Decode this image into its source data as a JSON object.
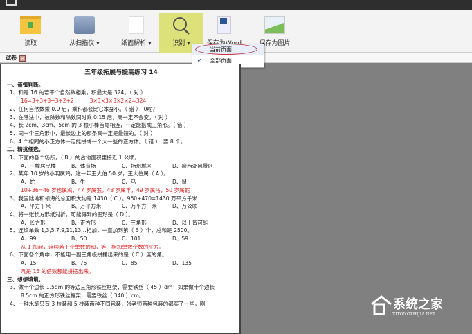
{
  "toolbar": {
    "items": [
      {
        "label": "读取"
      },
      {
        "label": "从扫描仪 ▾"
      },
      {
        "label": "纸面解析 ▾"
      },
      {
        "label": "识别 ▾"
      },
      {
        "label": "保存为Word"
      },
      {
        "label": "保存为图片"
      }
    ]
  },
  "tab": {
    "label": "试卷"
  },
  "dropdown": {
    "items": [
      {
        "label": "当前页面",
        "checked": false
      },
      {
        "label": "全部页面",
        "checked": true
      }
    ]
  },
  "doc": {
    "title": "五年级拓展与提高练习 14",
    "s1": "一、谨慎判断。",
    "s1q": [
      "1、和是 16 的若干个自然数相乘，积最大是 324。（ 对 ）",
      "16=3+3+3+3+2+2　　　3×3×3×3×2×2=324",
      "2、任何自然数乘 0.9 后，乘积都会比它本身小。（ 错 ）　0呢？",
      "3、在除法中，被除数和除数同时乘 0.15 后，商一定不会变。（ 对 ）",
      "4、长 2cm、3cm、5cm 的 3 根小棒首尾相连，一定能搭成三角形。（ 错 ）",
      "5、同一个三角形中，最长边上的那条高一定是最短的。（ 对 ）",
      "6、4 个相同的小正方体一定能拼成一个大一些的正方体。（ 错 ）　要 8 个。"
    ],
    "s2": "二、精挑细选。",
    "q1": "1、下面的各个场所，（ B ）的占地面积更接近 1 公顷。",
    "q1o": [
      "A、一幢居民楼",
      "B、体育场",
      "C、扬州城区",
      "D、瘦西湖风景区"
    ],
    "q2": "2、某年 10 岁的小明属鸡，这一年王大伯 50 岁，王大伯属（ A ）。",
    "q2o": [
      "A、蛇",
      "B、牛",
      "C、马",
      "D、鼠"
    ],
    "q2r": "10+36=46 岁也属鸡，47 岁属猴，48 岁属羊，49 岁属马，50 岁属蛇",
    "q3": "3、我国陆地和领海的总面积大约是 1430（ C ）。960+470=1430 万平方千米",
    "q3o": [
      "A、平方千米",
      "B、万平方米",
      "C、万平方千米",
      "D、万公顷"
    ],
    "q4": "4、将一张长方形纸对折，可能得到的图形是（ D ）。",
    "q4o": [
      "A、长方形",
      "B、正方形",
      "C、三角形",
      "D、以上皆可能"
    ],
    "q5": "5、连续单数 1,3,5,7,9,11,13…相加，一直加到第（ B ）个，总和是 2500。",
    "q5o": [
      "A、99",
      "B、50",
      "C、101",
      "D、59"
    ],
    "q5r": "从 1 加起，连续若干个单数的和，等于相加单数个数的平方。",
    "q6": "6、下面各个角中，不能用一副三角板拼摆出来的是（ C ）度的角。",
    "q6o": [
      "A、15",
      "B、75",
      "C、85",
      "D、135"
    ],
    "q6r": "凡是 15 的倍数都能拼摆出来。",
    "s3": "三、想想填填。",
    "t3a": "3、做十个边长 1.5dm 的等边三角形铁丝框架，需要铁丝（ 45 ）dm；如果做十个边长",
    "t3b": "8.5cm 的正方形铁丝框架，需要铁丝（ 340 ）cm。",
    "t4": "4、一种水笔只有 3 枝装和 5 枝装两种不同包装，张老师两种包装的都买了一些，刚"
  },
  "watermark": {
    "cn": "系统之家",
    "en": "XITONGZHIJIA.NET"
  }
}
